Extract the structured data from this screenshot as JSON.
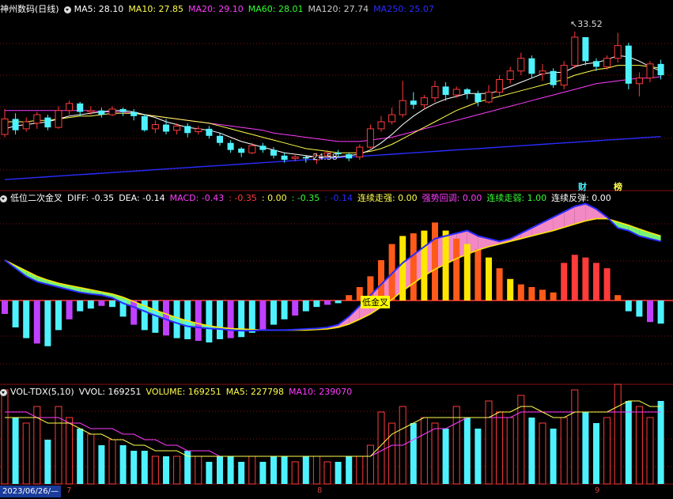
{
  "colors": {
    "bg": "#000000",
    "up": "#ff3b3b",
    "down": "#4ef2ff",
    "ma5": "#ffffff",
    "ma10": "#ffff4d",
    "ma20": "#ff3cff",
    "ma60": "#33ff33",
    "ma120": "#cccccc",
    "ma250": "#2a2cff",
    "grid": "#8a1010"
  },
  "main_panel": {
    "title": "神州数码(日线)",
    "legend": [
      {
        "label": "MA5: 28.10",
        "color": "#ffffff"
      },
      {
        "label": "MA10: 27.85",
        "color": "#ffff4d"
      },
      {
        "label": "MA20: 29.10",
        "color": "#ff3cff"
      },
      {
        "label": "MA60: 28.01",
        "color": "#33ff33"
      },
      {
        "label": "MA120: 27.74",
        "color": "#cccccc"
      },
      {
        "label": "MA250: 25.07",
        "color": "#2a2cff"
      }
    ],
    "high_label": "33.52",
    "low_label": "24.58",
    "badges": [
      "财",
      "榜"
    ]
  },
  "macd_panel": {
    "title": "低位二次金叉",
    "legend": [
      {
        "label": "DIFF: -0.35",
        "color": "#ffffff"
      },
      {
        "label": "DEA: -0.14",
        "color": "#ffffff"
      },
      {
        "label": "MACD: -0.43",
        "color": "#ff3cff"
      },
      {
        "label": ": -0.35",
        "color": "#ff3b3b"
      },
      {
        "label": ": 0.00",
        "color": "#ffff4d"
      },
      {
        "label": ": -0.35",
        "color": "#33ff33"
      },
      {
        "label": ": -0.14",
        "color": "#2a2cff"
      },
      {
        "label": "连续走强: 0.00",
        "color": "#ffff4d"
      },
      {
        "label": "强势回调: 0.00",
        "color": "#ff3cff"
      },
      {
        "label": "连续走弱: 1.00",
        "color": "#33ff33"
      },
      {
        "label": "连续反弹: 0.00",
        "color": "#ffffff"
      }
    ],
    "signal_label": "低金叉"
  },
  "vol_panel": {
    "title": "VOL-TDX(5,10)",
    "legend": [
      {
        "label": "VVOL: 169251",
        "color": "#ffffff"
      },
      {
        "label": "VOLUME: 169251",
        "color": "#ffff4d"
      },
      {
        "label": "MA5: 227798",
        "color": "#ffff4d"
      },
      {
        "label": "MA10: 239070",
        "color": "#ff3cff"
      }
    ]
  },
  "x_axis": {
    "date": "2023/06/26/—",
    "months": [
      "7",
      "8",
      "9"
    ]
  },
  "chart_data": {
    "type": "candlestick",
    "y_range_price": [
      23.5,
      35.5
    ],
    "candles": [
      [
        27.2,
        28.3,
        29.0,
        27.0
      ],
      [
        28.3,
        27.5,
        28.7,
        27.2
      ],
      [
        27.6,
        28.1,
        28.4,
        27.4
      ],
      [
        28.0,
        28.6,
        28.8,
        27.6
      ],
      [
        28.4,
        27.7,
        28.6,
        27.5
      ],
      [
        27.7,
        28.9,
        29.2,
        27.6
      ],
      [
        28.9,
        29.4,
        29.6,
        28.6
      ],
      [
        29.4,
        28.8,
        29.5,
        28.5
      ],
      [
        28.8,
        28.9,
        29.2,
        28.6
      ],
      [
        28.9,
        28.6,
        29.1,
        28.4
      ],
      [
        28.6,
        29.0,
        29.2,
        28.5
      ],
      [
        29.0,
        28.8,
        29.1,
        28.5
      ],
      [
        28.8,
        28.5,
        29.0,
        28.2
      ],
      [
        28.5,
        27.5,
        28.6,
        27.4
      ],
      [
        27.6,
        27.9,
        28.2,
        27.3
      ],
      [
        27.9,
        27.4,
        28.3,
        27.2
      ],
      [
        27.5,
        27.8,
        28.0,
        27.2
      ],
      [
        27.8,
        27.3,
        28.0,
        27.0
      ],
      [
        27.4,
        27.6,
        27.8,
        27.2
      ],
      [
        27.6,
        27.1,
        27.8,
        26.9
      ],
      [
        27.1,
        26.6,
        27.3,
        26.4
      ],
      [
        26.6,
        26.1,
        26.8,
        25.9
      ],
      [
        26.2,
        25.9,
        26.3,
        25.6
      ],
      [
        25.9,
        26.4,
        26.6,
        25.8
      ],
      [
        26.4,
        26.1,
        26.6,
        25.9
      ],
      [
        26.1,
        25.7,
        26.3,
        25.5
      ],
      [
        25.7,
        25.4,
        25.9,
        25.2
      ],
      [
        25.5,
        25.6,
        25.8,
        25.3
      ],
      [
        25.6,
        25.5,
        25.7,
        25.2
      ],
      [
        25.4,
        25.7,
        25.9,
        25.1
      ],
      [
        25.7,
        25.9,
        26.1,
        25.5
      ],
      [
        25.9,
        25.8,
        26.1,
        25.6
      ],
      [
        25.8,
        25.5,
        25.9,
        25.3
      ],
      [
        25.6,
        26.3,
        26.5,
        25.4
      ],
      [
        26.3,
        27.6,
        27.9,
        26.2
      ],
      [
        27.6,
        28.1,
        28.5,
        27.4
      ],
      [
        28.1,
        28.6,
        29.1,
        27.9
      ],
      [
        28.6,
        29.6,
        31.0,
        28.4
      ],
      [
        29.6,
        29.3,
        30.2,
        29.0
      ],
      [
        29.3,
        29.8,
        30.0,
        29.0
      ],
      [
        29.8,
        30.6,
        31.0,
        29.5
      ],
      [
        30.6,
        30.0,
        30.9,
        29.6
      ],
      [
        30.0,
        30.4,
        30.6,
        29.8
      ],
      [
        30.4,
        30.1,
        30.5,
        29.7
      ],
      [
        30.1,
        29.5,
        30.3,
        29.2
      ],
      [
        29.5,
        30.2,
        30.7,
        29.4
      ],
      [
        30.2,
        31.1,
        31.4,
        29.9
      ],
      [
        31.1,
        31.7,
        32.0,
        30.8
      ],
      [
        31.7,
        32.6,
        33.0,
        31.4
      ],
      [
        32.6,
        31.5,
        32.8,
        31.2
      ],
      [
        31.5,
        31.7,
        32.2,
        31.0
      ],
      [
        31.7,
        30.7,
        31.9,
        30.5
      ],
      [
        30.7,
        32.1,
        32.4,
        30.4
      ],
      [
        32.1,
        34.1,
        34.5,
        31.9
      ],
      [
        34.1,
        32.4,
        34.0,
        32.1
      ],
      [
        32.4,
        32.0,
        32.6,
        31.7
      ],
      [
        32.0,
        32.6,
        32.8,
        31.8
      ],
      [
        32.6,
        33.5,
        34.4,
        32.3
      ],
      [
        33.5,
        30.8,
        33.7,
        30.4
      ],
      [
        30.8,
        31.2,
        31.6,
        29.9
      ],
      [
        31.2,
        32.2,
        32.4,
        30.9
      ],
      [
        32.2,
        31.4,
        32.5,
        31.1
      ]
    ],
    "ma5": [
      27.6,
      27.8,
      27.9,
      28.0,
      28.1,
      28.3,
      28.5,
      28.6,
      28.7,
      28.8,
      28.9,
      28.9,
      28.8,
      28.6,
      28.4,
      28.1,
      27.9,
      27.7,
      27.6,
      27.5,
      27.3,
      27.0,
      26.7,
      26.5,
      26.3,
      26.1,
      25.9,
      25.8,
      25.7,
      25.6,
      25.6,
      25.6,
      25.7,
      25.8,
      26.1,
      26.6,
      27.2,
      27.9,
      28.5,
      29.0,
      29.4,
      29.7,
      29.9,
      30.1,
      30.1,
      30.1,
      30.3,
      30.6,
      30.9,
      31.2,
      31.5,
      31.6,
      31.6,
      32.0,
      32.2,
      32.3,
      32.5,
      32.8,
      32.7,
      32.4,
      32.0,
      31.7
    ],
    "ma10": [
      28.1,
      28.1,
      28.1,
      28.2,
      28.2,
      28.3,
      28.4,
      28.5,
      28.5,
      28.6,
      28.7,
      28.7,
      28.7,
      28.6,
      28.5,
      28.4,
      28.3,
      28.2,
      28.1,
      28.0,
      27.8,
      27.6,
      27.4,
      27.2,
      27.0,
      26.8,
      26.6,
      26.4,
      26.2,
      26.1,
      26.0,
      25.9,
      25.9,
      25.9,
      26.0,
      26.2,
      26.5,
      26.9,
      27.3,
      27.7,
      28.1,
      28.5,
      28.9,
      29.2,
      29.5,
      29.7,
      29.9,
      30.1,
      30.3,
      30.5,
      30.7,
      30.9,
      31.1,
      31.4,
      31.6,
      31.8,
      31.9,
      32.1,
      32.1,
      32.1,
      32.0,
      31.9
    ],
    "ma20": [
      28.9,
      28.9,
      28.9,
      28.9,
      28.9,
      28.9,
      28.9,
      28.9,
      28.9,
      28.8,
      28.8,
      28.8,
      28.7,
      28.6,
      28.5,
      28.4,
      28.3,
      28.2,
      28.1,
      28.0,
      27.9,
      27.8,
      27.7,
      27.6,
      27.5,
      27.3,
      27.2,
      27.1,
      27.0,
      26.9,
      26.8,
      26.7,
      26.7,
      26.7,
      26.8,
      26.9,
      27.0,
      27.2,
      27.4,
      27.6,
      27.8,
      28.0,
      28.2,
      28.4,
      28.6,
      28.8,
      29.0,
      29.2,
      29.4,
      29.6,
      29.8,
      30.0,
      30.2,
      30.4,
      30.6,
      30.8,
      30.9,
      31.0,
      31.1,
      31.2,
      31.2,
      31.3
    ],
    "ma250": [
      24.0,
      24.05,
      24.1,
      24.15,
      24.2,
      24.25,
      24.3,
      24.35,
      24.4,
      24.45,
      24.5,
      24.55,
      24.6,
      24.65,
      24.7,
      24.75,
      24.8,
      24.85,
      24.9,
      24.95,
      25.0,
      25.05,
      25.1,
      25.15,
      25.2,
      25.25,
      25.3,
      25.35,
      25.4,
      25.45,
      25.5,
      25.55,
      25.6,
      25.65,
      25.7,
      25.75,
      25.8,
      25.85,
      25.9,
      25.95,
      26.0,
      26.05,
      26.1,
      26.15,
      26.2,
      26.25,
      26.3,
      26.35,
      26.4,
      26.45,
      26.5,
      26.55,
      26.6,
      26.65,
      26.7,
      26.75,
      26.8,
      26.85,
      26.9,
      26.95,
      27.0,
      27.05
    ],
    "macd_hist": [
      -0.25,
      -0.5,
      -0.7,
      -0.8,
      -0.85,
      -0.55,
      -0.35,
      -0.2,
      -0.15,
      -0.1,
      -0.12,
      -0.3,
      -0.45,
      -0.55,
      -0.6,
      -0.65,
      -0.7,
      -0.72,
      -0.75,
      -0.78,
      -0.72,
      -0.7,
      -0.68,
      -0.6,
      -0.55,
      -0.45,
      -0.35,
      -0.28,
      -0.2,
      -0.12,
      -0.08,
      -0.05,
      0.1,
      0.25,
      0.45,
      0.75,
      1.05,
      1.2,
      1.25,
      1.3,
      1.45,
      1.3,
      1.15,
      1.05,
      0.95,
      0.8,
      0.6,
      0.4,
      0.3,
      0.25,
      0.2,
      0.15,
      0.7,
      0.85,
      0.8,
      0.7,
      0.6,
      0.1,
      -0.2,
      -0.3,
      -0.4,
      -0.43
    ],
    "macd_diff": [
      0.75,
      0.6,
      0.45,
      0.35,
      0.3,
      0.25,
      0.2,
      0.15,
      0.12,
      0.1,
      0.05,
      -0.05,
      -0.12,
      -0.2,
      -0.28,
      -0.35,
      -0.42,
      -0.48,
      -0.5,
      -0.52,
      -0.53,
      -0.55,
      -0.56,
      -0.56,
      -0.55,
      -0.55,
      -0.55,
      -0.54,
      -0.53,
      -0.52,
      -0.5,
      -0.45,
      -0.3,
      -0.1,
      0.1,
      0.3,
      0.5,
      0.7,
      0.85,
      1.0,
      1.15,
      1.2,
      1.25,
      1.3,
      1.2,
      1.15,
      1.1,
      1.15,
      1.25,
      1.35,
      1.45,
      1.55,
      1.65,
      1.75,
      1.8,
      1.7,
      1.55,
      1.35,
      1.3,
      1.2,
      1.15,
      1.1
    ],
    "macd_dea": [
      0.75,
      0.65,
      0.55,
      0.45,
      0.38,
      0.32,
      0.28,
      0.24,
      0.2,
      0.16,
      0.12,
      0.06,
      -0.02,
      -0.1,
      -0.18,
      -0.25,
      -0.32,
      -0.38,
      -0.43,
      -0.47,
      -0.5,
      -0.52,
      -0.53,
      -0.54,
      -0.55,
      -0.55,
      -0.55,
      -0.55,
      -0.55,
      -0.54,
      -0.53,
      -0.5,
      -0.44,
      -0.35,
      -0.25,
      -0.12,
      0.02,
      0.18,
      0.32,
      0.46,
      0.58,
      0.68,
      0.78,
      0.86,
      0.94,
      1.0,
      1.05,
      1.1,
      1.15,
      1.2,
      1.25,
      1.3,
      1.36,
      1.42,
      1.48,
      1.52,
      1.52,
      1.46,
      1.4,
      1.33,
      1.26,
      1.2
    ],
    "volume": [
      17,
      12,
      11,
      14,
      8,
      14,
      12,
      10,
      9,
      7,
      8,
      7,
      6,
      6,
      5,
      5,
      5,
      6,
      5,
      4,
      5,
      5,
      4,
      5,
      4,
      5,
      5,
      4,
      5,
      5,
      4,
      4,
      5,
      5,
      7,
      13,
      11,
      14,
      11,
      12,
      11,
      10,
      14,
      12,
      10,
      15,
      13,
      12,
      16,
      12,
      11,
      10,
      12,
      17,
      13,
      11,
      12,
      18,
      15,
      14,
      12,
      15
    ],
    "vol_ma5": [
      12,
      12,
      12,
      12,
      11,
      11,
      11,
      10,
      9,
      9,
      8,
      8,
      7,
      7,
      6,
      6,
      6,
      5,
      5,
      5,
      5,
      5,
      5,
      5,
      5,
      5,
      5,
      5,
      5,
      5,
      5,
      5,
      5,
      5,
      5,
      7,
      9,
      10,
      11,
      12,
      12,
      12,
      12,
      12,
      12,
      12,
      13,
      13,
      14,
      14,
      13,
      12,
      12,
      13,
      13,
      13,
      13,
      14,
      15,
      15,
      14,
      14
    ],
    "vol_ma10": [
      13,
      13,
      13,
      12,
      12,
      12,
      11,
      11,
      10,
      10,
      10,
      9,
      9,
      8,
      8,
      7,
      7,
      6,
      6,
      6,
      5,
      5,
      5,
      5,
      5,
      5,
      5,
      5,
      5,
      5,
      5,
      5,
      5,
      5,
      5,
      6,
      7,
      7,
      8,
      9,
      10,
      10,
      11,
      12,
      12,
      12,
      12,
      12,
      13,
      13,
      13,
      13,
      13,
      13,
      13,
      13,
      13,
      13,
      13,
      13,
      13,
      13
    ]
  }
}
